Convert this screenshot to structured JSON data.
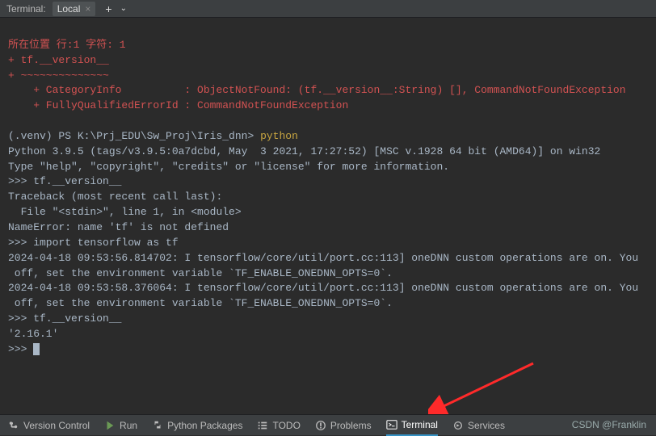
{
  "top": {
    "panel_label": "Terminal:",
    "tab_label": "Local",
    "plus": "+",
    "chev": "⌄"
  },
  "lines": {
    "l1": "所在位置 行:1 字符: 1",
    "l2": "+ tf.__version__",
    "l3": "+ ~~~~~~~~~~~~~~",
    "l4": "    + CategoryInfo          : ObjectNotFound: (tf.__version__:String) [], CommandNotFoundException",
    "l5": "    + FullyQualifiedErrorId : CommandNotFoundException",
    "blank1": " ",
    "prompt1": "(.venv) PS K:\\Prj_EDU\\Sw_Proj\\Iris_dnn> ",
    "cmd1": "python",
    "py1": "Python 3.9.5 (tags/v3.9.5:0a7dcbd, May  3 2021, 17:27:52) [MSC v.1928 64 bit (AMD64)] on win32",
    "py2": "Type \"help\", \"copyright\", \"credits\" or \"license\" for more information.",
    "r1": ">>> tf.__version__",
    "tb1": "Traceback (most recent call last):",
    "tb2": "  File \"<stdin>\", line 1, in <module>",
    "tb3": "NameError: name 'tf' is not defined",
    "r2": ">>> import tensorflow as tf",
    "dnn1": "2024-04-18 09:53:56.814702: I tensorflow/core/util/port.cc:113] oneDNN custom operations are on. You",
    "dnn1b": " off, set the environment variable `TF_ENABLE_ONEDNN_OPTS=0`.",
    "dnn2": "2024-04-18 09:53:58.376064: I tensorflow/core/util/port.cc:113] oneDNN custom operations are on. You",
    "dnn2b": " off, set the environment variable `TF_ENABLE_ONEDNN_OPTS=0`.",
    "r3": ">>> tf.__version__",
    "ver": "'2.16.1'",
    "r4": ">>> "
  },
  "bottom": {
    "vcs": "Version Control",
    "run": "Run",
    "pkg": "Python Packages",
    "todo": "TODO",
    "problems": "Problems",
    "terminal": "Terminal",
    "services": "Services"
  },
  "watermark": "CSDN @Franklin"
}
